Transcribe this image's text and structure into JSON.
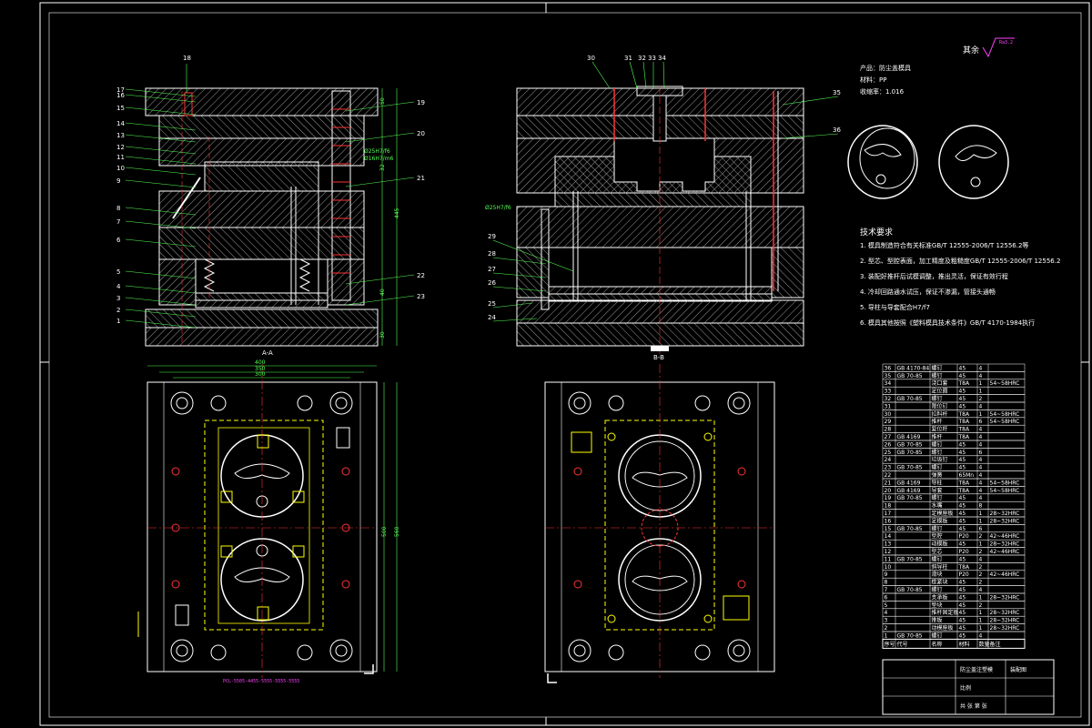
{
  "title_top": "技术要求",
  "product_info": {
    "product": "产品：防尘盖模具",
    "material": "材料：PP",
    "shrink": "收缩率：1.016"
  },
  "roughness": {
    "label": "其余",
    "value": "Ra3.2"
  },
  "requirements": [
    "1. 模具制造符合有关标准GB/T 12555-2006/T 12556.2等",
    "2. 型芯、型腔表面，加工精度及粗糙度GB/T 12555-2006/T 12556.2",
    "3. 装配好推杆后试模调整，推出灵活，保证有效行程",
    "4. 冷却回路通水试压，保证不渗漏，管接头通畅",
    "5. 导柱与导套配合H7/f7",
    "6. 模具其他按照《塑料模具技术条件》GB/T 4170-1984执行"
  ],
  "dims": {
    "section_views": "A-A",
    "section_views2": "B-B",
    "d400": "400",
    "d350": "350",
    "d300": "300",
    "d560": "560",
    "d500": "500",
    "d445": "445",
    "d30": "30",
    "d50": "50",
    "d32": "32",
    "d40": "40",
    "fit1": "Ø25H7/f6",
    "fit2": "Ø16H7/m6",
    "fit3": "Ø25H7/f6",
    "magenta_note": "PCL-5505-4455-5555-5555-5555"
  },
  "left_labels": [
    "1",
    "2",
    "3",
    "4",
    "5",
    "6",
    "7",
    "8",
    "9",
    "10",
    "11",
    "12",
    "13",
    "14",
    "15",
    "16",
    "17",
    "18"
  ],
  "right_labels_a": [
    "19",
    "20",
    "21",
    "22",
    "23"
  ],
  "mid_labels": [
    "24",
    "25",
    "26",
    "27",
    "28",
    "29",
    "30",
    "31",
    "32",
    "33",
    "34",
    "35",
    "36"
  ],
  "bom_rows": [
    [
      "36",
      "GB 4170-84",
      "螺钉",
      "45",
      "4",
      ""
    ],
    [
      "35",
      "GB 70-85",
      "螺钉",
      "45",
      "4",
      ""
    ],
    [
      "34",
      "",
      "浇口套",
      "T8A",
      "1",
      "54~58HRC"
    ],
    [
      "33",
      "",
      "定位圈",
      "45",
      "1",
      ""
    ],
    [
      "32",
      "GB 70-85",
      "螺钉",
      "45",
      "2",
      ""
    ],
    [
      "31",
      "",
      "限位钉",
      "45",
      "4",
      ""
    ],
    [
      "30",
      "",
      "拉料杆",
      "T8A",
      "1",
      "54~58HRC"
    ],
    [
      "29",
      "",
      "推杆",
      "T8A",
      "6",
      "54~58HRC"
    ],
    [
      "28",
      "",
      "复位杆",
      "T8A",
      "4",
      ""
    ],
    [
      "27",
      "GB 4169",
      "推杆",
      "T8A",
      "4",
      ""
    ],
    [
      "26",
      "GB 70-85",
      "螺钉",
      "45",
      "4",
      ""
    ],
    [
      "25",
      "GB 70-85",
      "螺钉",
      "45",
      "6",
      ""
    ],
    [
      "24",
      "",
      "垃圾钉",
      "45",
      "4",
      ""
    ],
    [
      "23",
      "GB 70-85",
      "螺钉",
      "45",
      "4",
      ""
    ],
    [
      "22",
      "",
      "弹簧",
      "65Mn",
      "4",
      ""
    ],
    [
      "21",
      "GB 4169",
      "导柱",
      "T8A",
      "4",
      "54~58HRC"
    ],
    [
      "20",
      "GB 4169",
      "导套",
      "T8A",
      "4",
      "54~58HRC"
    ],
    [
      "19",
      "GB 70-85",
      "螺钉",
      "45",
      "4",
      ""
    ],
    [
      "18",
      "",
      "水嘴",
      "45",
      "8",
      ""
    ],
    [
      "17",
      "",
      "定模座板",
      "45",
      "1",
      "28~32HRC"
    ],
    [
      "16",
      "",
      "定模板",
      "45",
      "1",
      "28~32HRC"
    ],
    [
      "15",
      "GB 70-85",
      "螺钉",
      "45",
      "6",
      ""
    ],
    [
      "14",
      "",
      "型腔",
      "P20",
      "2",
      "42~46HRC"
    ],
    [
      "13",
      "",
      "动模板",
      "45",
      "1",
      "28~32HRC"
    ],
    [
      "12",
      "",
      "型芯",
      "P20",
      "2",
      "42~46HRC"
    ],
    [
      "11",
      "GB 70-85",
      "螺钉",
      "45",
      "4",
      ""
    ],
    [
      "10",
      "",
      "斜导柱",
      "T8A",
      "2",
      ""
    ],
    [
      "9",
      "",
      "滑块",
      "P20",
      "2",
      "42~46HRC"
    ],
    [
      "8",
      "",
      "楔紧块",
      "45",
      "2",
      ""
    ],
    [
      "7",
      "GB 70-85",
      "螺钉",
      "45",
      "4",
      ""
    ],
    [
      "6",
      "",
      "支承板",
      "45",
      "1",
      "28~32HRC"
    ],
    [
      "5",
      "",
      "垫块",
      "45",
      "2",
      ""
    ],
    [
      "4",
      "",
      "推杆固定板",
      "45",
      "1",
      "28~32HRC"
    ],
    [
      "3",
      "",
      "推板",
      "45",
      "1",
      "28~32HRC"
    ],
    [
      "2",
      "",
      "动模座板",
      "45",
      "1",
      "28~32HRC"
    ],
    [
      "1",
      "GB 70-85",
      "螺钉",
      "45",
      "4",
      ""
    ]
  ],
  "bom_header": [
    "序号",
    "代号",
    "名称",
    "材料",
    "数量",
    "备注"
  ],
  "title_block": {
    "name": "防尘盖注塑模",
    "company": "装配图",
    "scale": "比例",
    "sheet": "共 张 第 张"
  },
  "colors": {
    "bg": "#000000",
    "line": "#ffffff",
    "green": "#55ff55",
    "yellow": "#ffff00",
    "magenta": "#ff44ff",
    "red": "#ff3333",
    "hatch": "#bbbbbb"
  }
}
